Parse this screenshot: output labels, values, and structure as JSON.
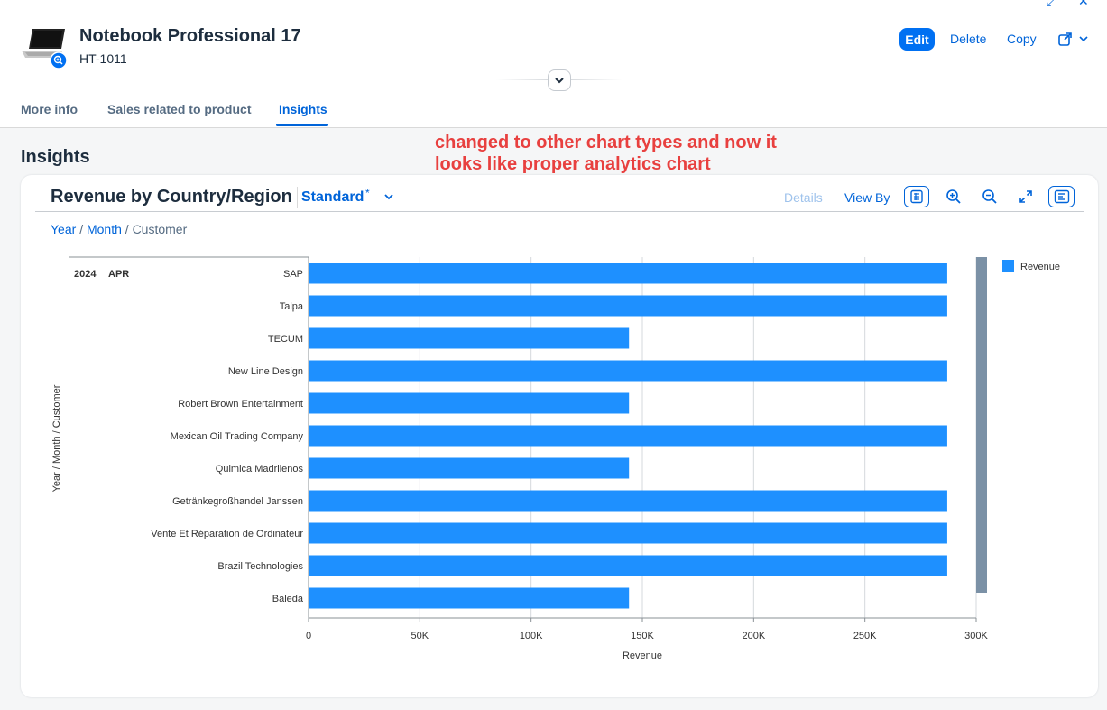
{
  "header": {
    "title": "Notebook Professional 17",
    "id": "HT-1011",
    "actions": {
      "edit": "Edit",
      "delete": "Delete",
      "copy": "Copy"
    }
  },
  "tabs": [
    "More info",
    "Sales related to product",
    "Insights"
  ],
  "annotation": "changed to other chart types and now it looks like proper analytics chart",
  "section_title": "Insights",
  "card": {
    "title": "Revenue by Country/Region",
    "variant": "Standard",
    "variant_modified": "*",
    "toolbar": {
      "details": "Details",
      "view_by": "View By"
    },
    "drilldown": {
      "year": "Year",
      "month": "Month",
      "customer": "Customer",
      "sep": "/"
    }
  },
  "chart_data": {
    "type": "bar",
    "orientation": "horizontal",
    "group": {
      "year": "2024",
      "month": "APR"
    },
    "categories": [
      "SAP",
      "Talpa",
      "TECUM",
      "New Line Design",
      "Robert Brown Entertainment",
      "Mexican Oil Trading Company",
      "Quimica Madrilenos",
      "Getränkegroßhandel Janssen",
      "Vente Et Réparation de Ordinateur",
      "Brazil Technologies",
      "Baleda"
    ],
    "series": [
      {
        "name": "Revenue",
        "color": "#1e90ff",
        "values": [
          287000,
          287000,
          144000,
          287000,
          144000,
          287000,
          144000,
          287000,
          287000,
          287000,
          144000
        ]
      }
    ],
    "xlabel": "Revenue",
    "ylabel": "Year / Month / Customer",
    "xlim": [
      0,
      300000
    ],
    "xticks": [
      "0",
      "50K",
      "100K",
      "150K",
      "200K",
      "250K",
      "300K"
    ],
    "grid": true,
    "legend": "top-right"
  }
}
